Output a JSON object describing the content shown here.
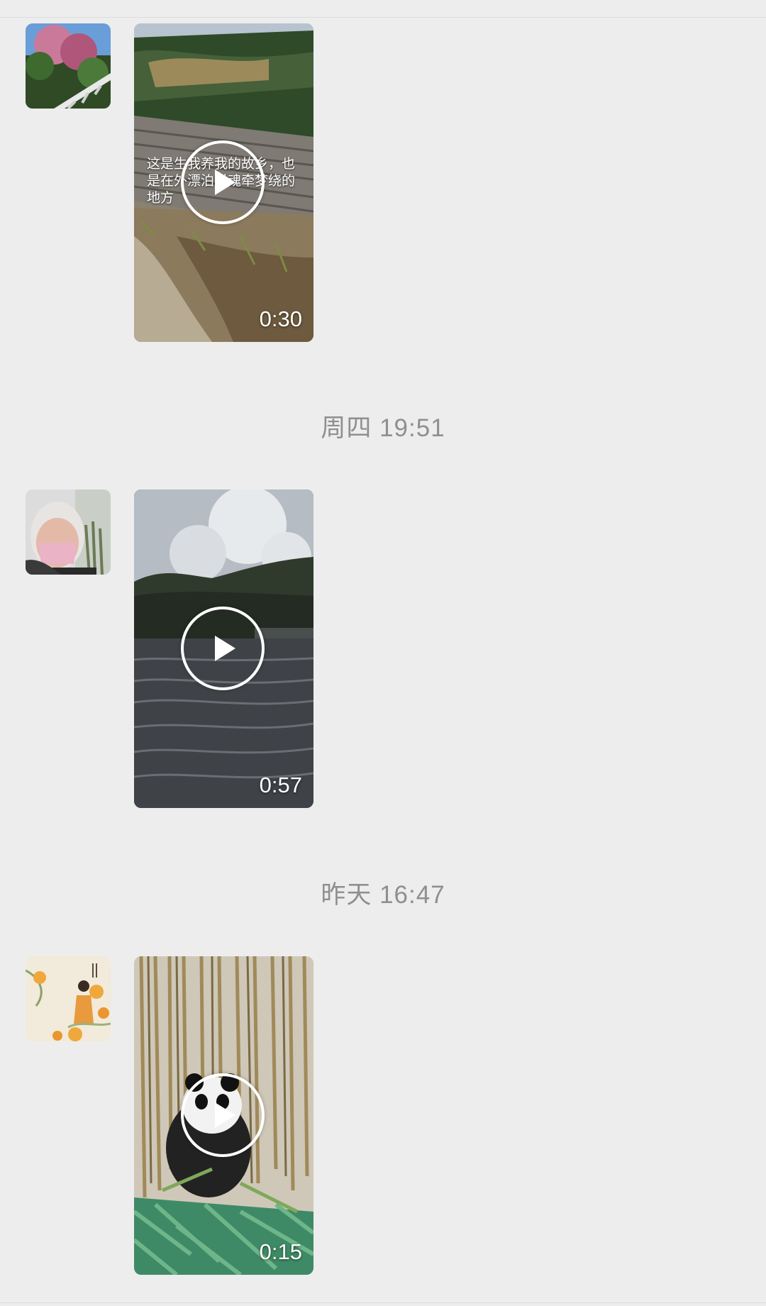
{
  "messages": [
    {
      "overlay_text": "这是生我养我的故乡，也是在外漂泊时魂牵梦绕的地方",
      "duration": "0:30"
    },
    {
      "timestamp": "周四 19:51",
      "duration": "0:57"
    },
    {
      "timestamp": "昨天 16:47",
      "duration": "0:15"
    }
  ],
  "icons": {
    "play": "play-icon"
  },
  "colors": {
    "background": "#ededed",
    "timestamp": "#8f8f8f"
  }
}
